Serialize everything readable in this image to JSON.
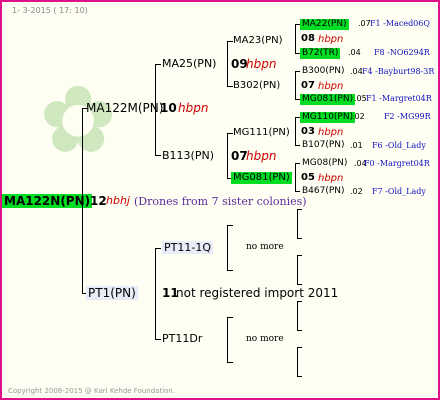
{
  "header": {
    "date": "1-  3-2015 ( 17: 10)"
  },
  "footer": {
    "copyright": "Copyright 2008-2015 @ Karl Kehde Foundation."
  },
  "root": {
    "name": "MA122N(PN)",
    "gen": "12",
    "tag": "hbhj",
    "note": "(Drones from 7 sister colonies)"
  },
  "gen1": {
    "sire": {
      "name": "MA122M(PN)",
      "gen": "10",
      "tag": "hbpn"
    },
    "dam": {
      "name": "PT1(PN)",
      "gen": "11",
      "note": "not registered import 2011"
    }
  },
  "gen2": {
    "ma25": {
      "name": "MA25(PN)",
      "gen": "09",
      "tag": "hbpn"
    },
    "b113": {
      "name": "B113(PN)"
    },
    "pt11q": {
      "name": "PT11-1Q",
      "more": "no more"
    },
    "pt11dr": {
      "name": "PT11Dr",
      "more": "no more"
    }
  },
  "gen3": {
    "ma23": {
      "name": "MA23(PN)",
      "gen": "08",
      "tag": "hbpn"
    },
    "b302": {
      "name": "B302(PN)"
    },
    "mg111": {
      "name": "MG111(PN)",
      "gen": "07",
      "tag": "hbpn"
    },
    "mg081": {
      "name": "MG081(PN)",
      "gen": "05",
      "tag": "hbpn"
    }
  },
  "gen4": [
    {
      "name": "MA22(PN)",
      "num": ".07",
      "rel": "F1 -Maced06Q"
    },
    {
      "name": "B72(TR)",
      "num": ".04",
      "rel": "F8 -NO6294R"
    },
    {
      "name": "B300(PN)",
      "num": ".04",
      "rel": "F4 -Bayburt98-3R"
    },
    {
      "name": "MG081(PN)",
      "num": ".05",
      "rel": "F1 -Margret04R"
    },
    {
      "name": "MG110(PN)",
      "num": ".02",
      "rel": "F2 -MG99R"
    },
    {
      "name": "B107(PN)",
      "num": ".01",
      "rel": "F6 -Old_Lady"
    },
    {
      "name": "MG08(PN)",
      "num": ".04",
      "rel": "F0 -Margret04R"
    },
    {
      "name": "B467(PN)",
      "num": ".02",
      "rel": "F7 -Old_Lady"
    }
  ],
  "gen3codes": {
    "ma23": "08",
    "b302": "07",
    "mg111": "03",
    "mg081": "05"
  }
}
